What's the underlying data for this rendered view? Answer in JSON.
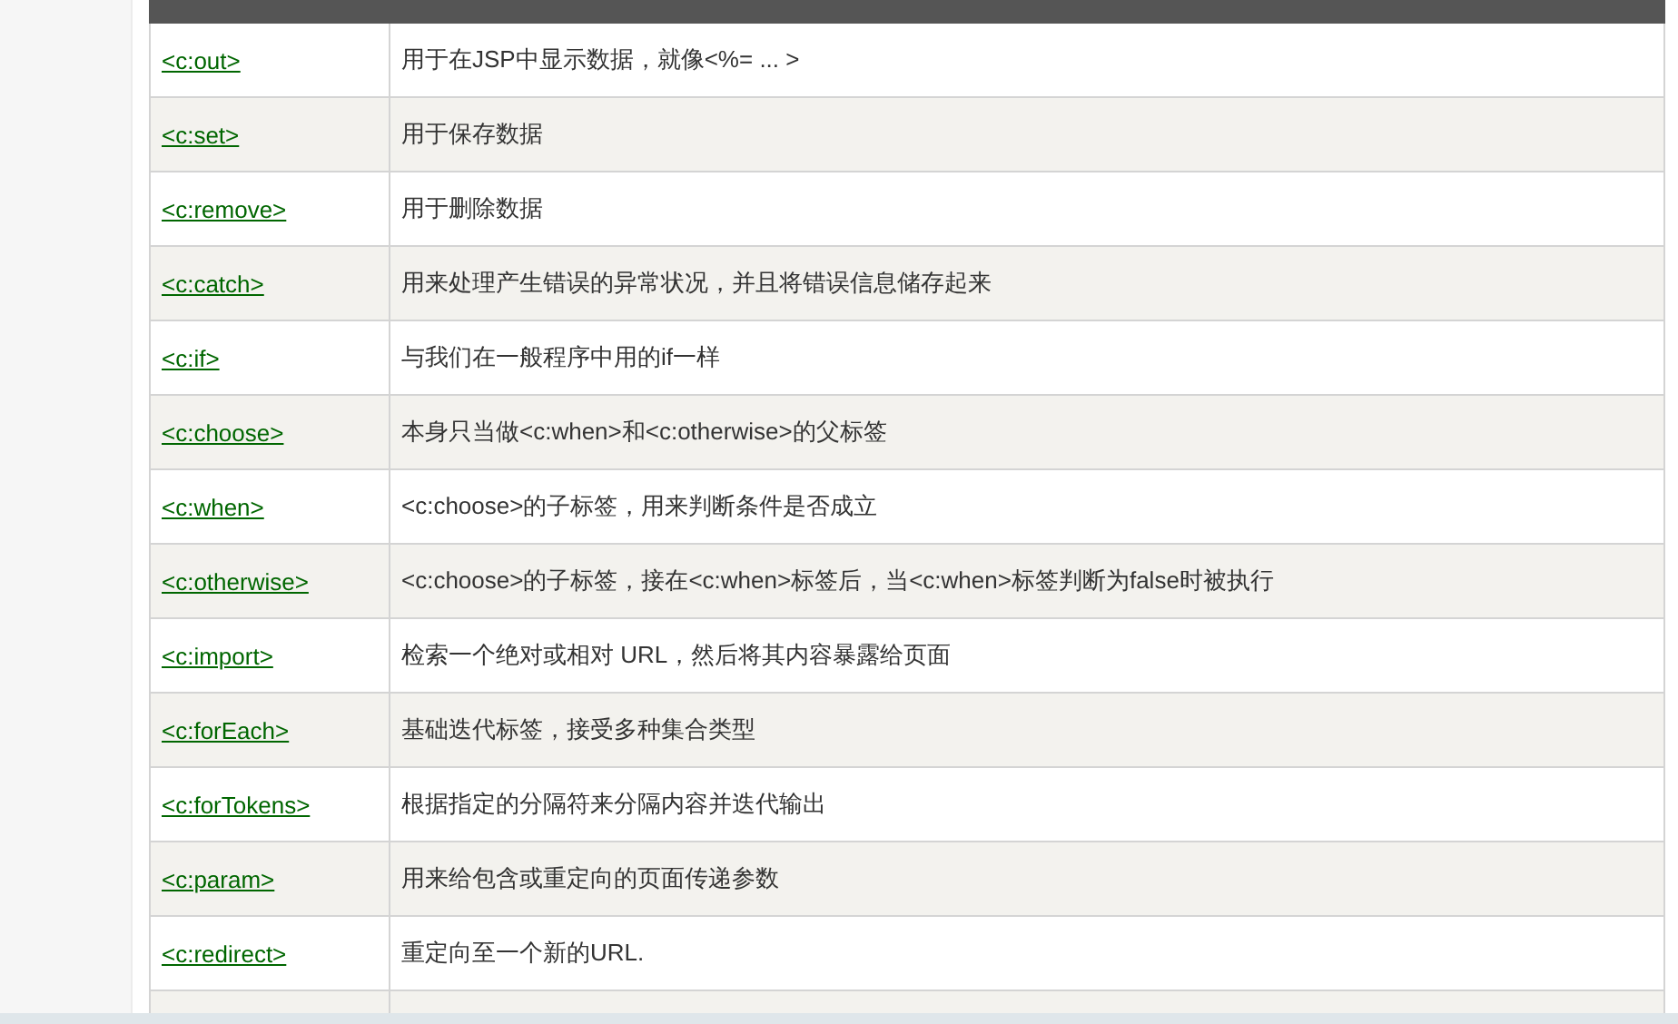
{
  "table": {
    "rows": [
      {
        "tag": "<c:out>",
        "description": "用于在JSP中显示数据，就像<%= ... >"
      },
      {
        "tag": "<c:set>",
        "description": "用于保存数据"
      },
      {
        "tag": "<c:remove>",
        "description": "用于删除数据"
      },
      {
        "tag": "<c:catch>",
        "description": "用来处理产生错误的异常状况，并且将错误信息储存起来"
      },
      {
        "tag": "<c:if>",
        "description": "与我们在一般程序中用的if一样"
      },
      {
        "tag": "<c:choose>",
        "description": "本身只当做<c:when>和<c:otherwise>的父标签"
      },
      {
        "tag": "<c:when>",
        "description": "<c:choose>的子标签，用来判断条件是否成立"
      },
      {
        "tag": "<c:otherwise>",
        "description": "<c:choose>的子标签，接在<c:when>标签后，当<c:when>标签判断为false时被执行"
      },
      {
        "tag": "<c:import>",
        "description": "检索一个绝对或相对 URL，然后将其内容暴露给页面"
      },
      {
        "tag": "<c:forEach>",
        "description": "基础迭代标签，接受多种集合类型"
      },
      {
        "tag": "<c:forTokens>",
        "description": "根据指定的分隔符来分隔内容并迭代输出"
      },
      {
        "tag": "<c:param>",
        "description": "用来给包含或重定向的页面传递参数"
      },
      {
        "tag": "<c:redirect>",
        "description": "重定向至一个新的URL."
      }
    ]
  }
}
